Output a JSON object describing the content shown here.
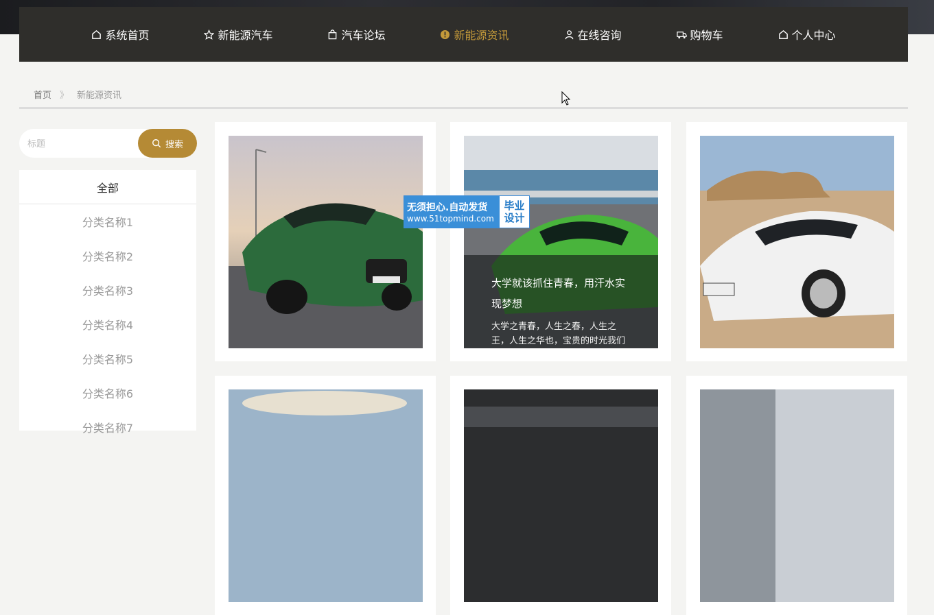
{
  "nav": {
    "items": [
      {
        "label": "系统首页",
        "icon": "home-icon"
      },
      {
        "label": "新能源汽车",
        "icon": "star-icon"
      },
      {
        "label": "汽车论坛",
        "icon": "bag-icon"
      },
      {
        "label": "新能源资讯",
        "icon": "info-icon",
        "active": true
      },
      {
        "label": "在线咨询",
        "icon": "user-icon"
      },
      {
        "label": "购物车",
        "icon": "truck-icon"
      },
      {
        "label": "个人中心",
        "icon": "home-icon"
      }
    ],
    "active_color": "#c49a3a"
  },
  "breadcrumb": {
    "home": "首页",
    "separator": "》",
    "current": "新能源资讯"
  },
  "search": {
    "placeholder": "标题",
    "button_label": "搜索"
  },
  "categories": {
    "all_label": "全部",
    "items": [
      "分类名称1",
      "分类名称2",
      "分类名称3",
      "分类名称4",
      "分类名称5",
      "分类名称6",
      "分类名称7"
    ]
  },
  "news": {
    "hover_card": {
      "title": "大学就该抓住青春，用汗水实现梦想",
      "desc": "大学之青春，人生之春，人生之王，人生之华也，宝贵的时光我们理当去珍惜。然而，当我们..."
    }
  },
  "watermark": {
    "line1": "无须担心.自动发货",
    "line2": "www.51topmind.com",
    "right": "毕业设计"
  },
  "colors": {
    "accent": "#b58a35",
    "nav_bg": "#2f2e2b"
  }
}
